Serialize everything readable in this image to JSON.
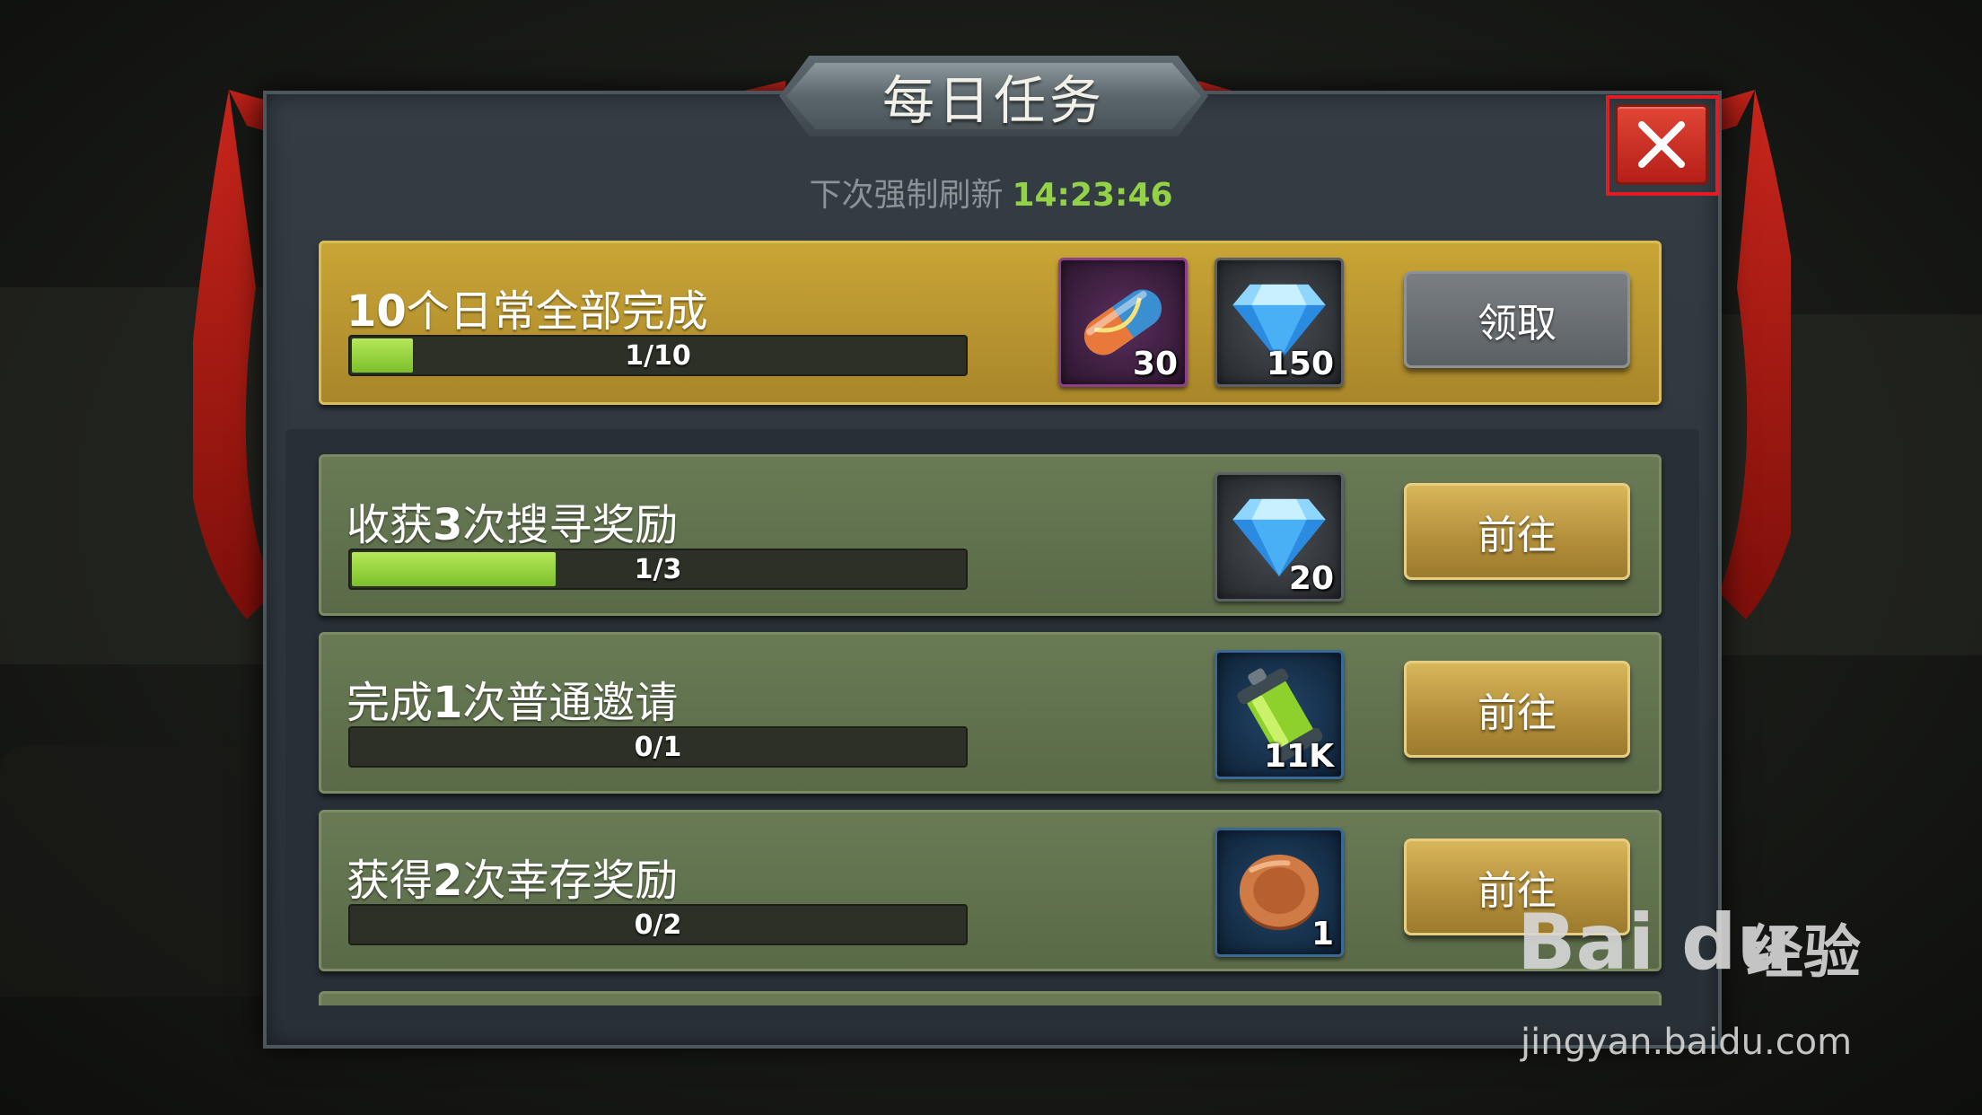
{
  "dialog": {
    "title": "每日任务",
    "refresh_label": "下次强制刷新",
    "refresh_time": "14:23:46"
  },
  "tasks": [
    {
      "title_parts": [
        "10",
        "个日常全部完成",
        ""
      ],
      "progress_text": "1/10",
      "progress": 0.1,
      "rewards": [
        {
          "icon": "serum-capsule-icon",
          "qty": "30"
        },
        {
          "icon": "diamond-icon",
          "qty": "150"
        }
      ],
      "button": "领取"
    },
    {
      "title_parts": [
        "收获",
        "3",
        "次搜寻奖励"
      ],
      "progress_text": "1/3",
      "progress": 0.3333,
      "rewards": [
        {
          "icon": "diamond-icon",
          "qty": "20"
        }
      ],
      "button": "前往"
    },
    {
      "title_parts": [
        "完成",
        "1",
        "次普通邀请"
      ],
      "progress_text": "0/1",
      "progress": 0,
      "rewards": [
        {
          "icon": "fuel-canister-icon",
          "qty": "11K"
        }
      ],
      "button": "前往"
    },
    {
      "title_parts": [
        "获得",
        "2",
        "次幸存奖励"
      ],
      "progress_text": "0/2",
      "progress": 0,
      "rewards": [
        {
          "icon": "copper-coin-icon",
          "qty": "1"
        }
      ],
      "button": "前往"
    }
  ],
  "watermark": {
    "logo": "Bai du",
    "brand_cn": "经验",
    "url": "jingyan.baidu.com"
  },
  "colors": {
    "timer_green": "#93d146",
    "progress_fill": "#9ad647",
    "gold_row": "#c9a536",
    "green_row": "#647551",
    "close_red": "#d0342a"
  }
}
